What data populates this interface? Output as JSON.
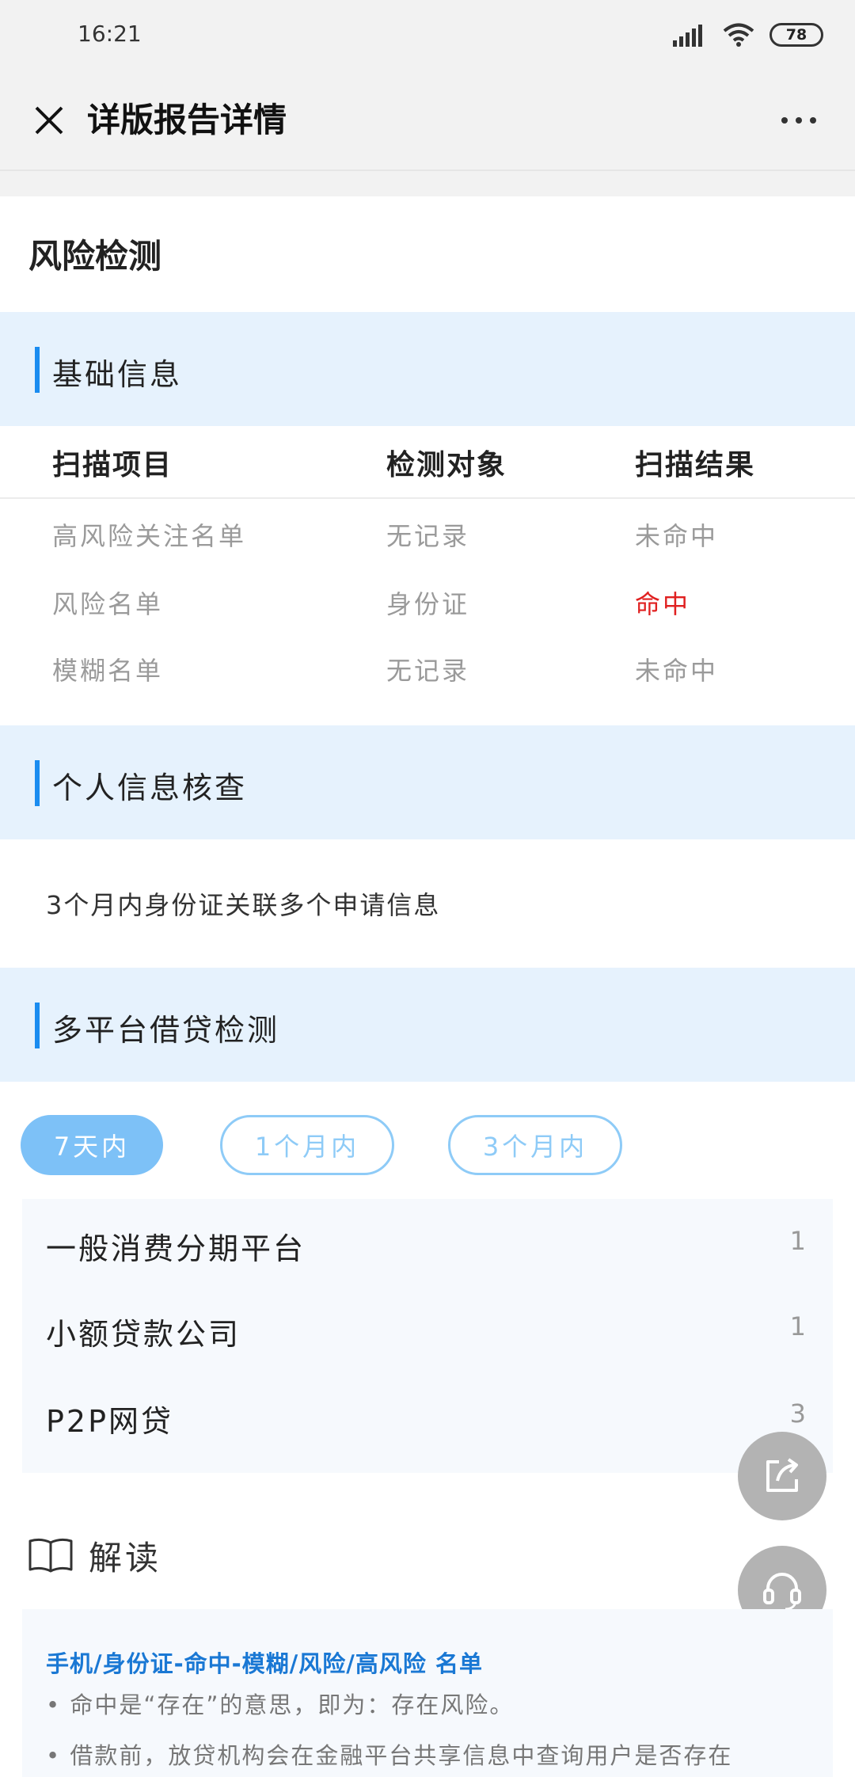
{
  "status": {
    "time": "16:21",
    "battery": "78"
  },
  "nav": {
    "title": "详版报告详情"
  },
  "section": {
    "title": "风险检测"
  },
  "basic": {
    "title": "基础信息",
    "headers": [
      "扫描项目",
      "检测对象",
      "扫描结果"
    ],
    "rows": [
      {
        "item": "高风险关注名单",
        "target": "无记录",
        "result": "未命中",
        "hit": false
      },
      {
        "item": "风险名单",
        "target": "身份证",
        "result": "命中",
        "hit": true
      },
      {
        "item": "模糊名单",
        "target": "无记录",
        "result": "未命中",
        "hit": false
      }
    ],
    "hit_color": "#e02020"
  },
  "personal": {
    "title": "个人信息核查",
    "text": "3个月内身份证关联多个申请信息"
  },
  "loan": {
    "title": "多平台借贷检测",
    "tabs": [
      {
        "label": "7天内",
        "active": true
      },
      {
        "label": "1个月内",
        "active": false
      },
      {
        "label": "3个月内",
        "active": false
      }
    ],
    "items": [
      {
        "name": "一般消费分期平台",
        "count": "1"
      },
      {
        "name": "小额贷款公司",
        "count": "1"
      },
      {
        "name": "P2P网贷",
        "count": "3"
      }
    ]
  },
  "interpretation": {
    "title": "解读",
    "subtitle": "手机/身份证-命中-模糊/风险/高风险 名单",
    "bullets": [
      "• 命中是“存在”的意思，即为：存在风险。",
      "• 借款前，放贷机构会在金融平台共享信息中查询用户是否存在"
    ]
  },
  "colors": {
    "accent": "#1a8cf0",
    "band": "#e6f2fd",
    "chip_active": "#7dc1f7"
  },
  "icons": [
    "close-icon",
    "more-icon",
    "share-icon",
    "headset-icon",
    "book-icon",
    "signal-icon",
    "wifi-icon"
  ]
}
